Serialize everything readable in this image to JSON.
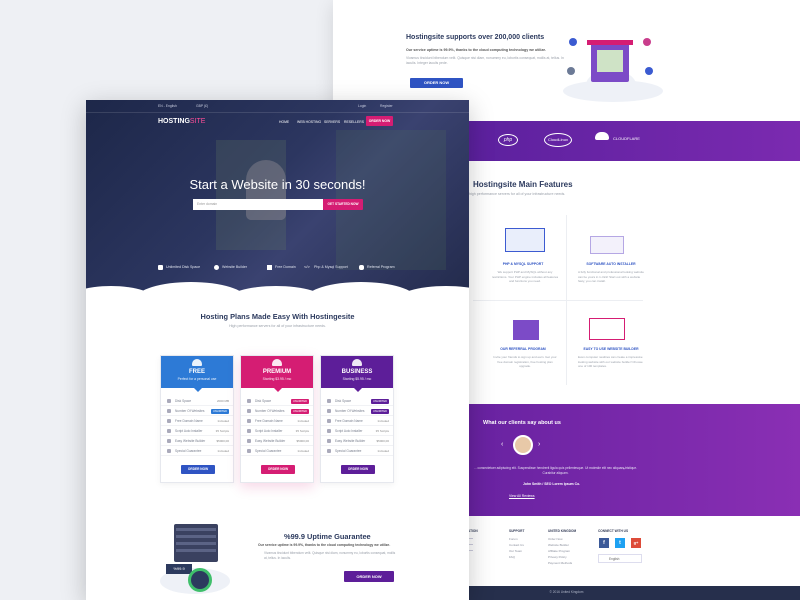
{
  "back": {
    "intro_title": "Hostingsite supports over 200,000 clients",
    "intro_sub": "Our service uptime is 99.9%, thanks to the cloud computing technology we utilize.",
    "intro_body": "Vivamus tincidunt bibendum velit. Quisque nisi diam, nonummy eu, lobortis consequat, mollis at, tellus. In iaculis. Integer iaculis pede.",
    "intro_btn": "ORDER NOW",
    "partners": [
      "php",
      "CloudLinux",
      "CLOUDFLARE"
    ],
    "features_title": "Hostingsite Main Features",
    "features_sub": "high performance servers for all of your infrastructure needs.",
    "features": [
      {
        "title": "PHP & MYSQL SUPPORT",
        "text": "We support PHP and MySQL without any restrictions. Your PHP engine includes all features and functions you need."
      },
      {
        "title": "SOFTWARE AUTO INSTALLER",
        "text": "A fully functional and professional looking website can be yours in 1 click! Start out with a website fasty, you can install."
      },
      {
        "title": "OUR REFERRAL PROGRAM",
        "text": "Invite your friends to sign up and earn. Get your free domain registration, free hosting plan upgrade."
      },
      {
        "title": "EASY TO USE WEBSITE BUILDER",
        "text": "Even computer newbies can create a impressive looking website with our website builder! Choose one of 100 templates."
      }
    ],
    "testimonial_title": "What our clients say about us",
    "testimonial_text": "... consectetuer adipiscing elit. Suspendisse hendrerit ligula quis pellentesque. Ut molestie elit nec aliquam tristique. Curabitur aliquam.",
    "testimonial_author": "John Smith / SEO Lorem Ipsum Co.",
    "testimonial_link": "View All Reviews",
    "footer": {
      "cols": [
        {
          "title": "ATION",
          "items": [
            "",
            "",
            "",
            ""
          ]
        },
        {
          "title": "SUPPORT",
          "items": [
            "Forum",
            "Contact Us",
            "Our Team",
            "FAQ"
          ]
        },
        {
          "title": "UNITED KINGDOM",
          "items": [
            "Order Now",
            "Website Builder",
            "Affiliate Program",
            "Privacy Policy",
            "Payment Methods"
          ]
        },
        {
          "title": "CONNECT WITH US",
          "items": []
        }
      ],
      "language": "English",
      "copyright": "© 2016 United Kingdom"
    }
  },
  "front": {
    "topbar": {
      "language": "EN - English",
      "currency": "GBP (£)",
      "login": "Login",
      "register": "Register"
    },
    "logo_main": "HOSTING",
    "logo_accent": "SITE",
    "nav": [
      "HOME",
      "WEB HOSTING",
      "SERVERS",
      "RESELLERS"
    ],
    "nav_cta": "ORDER NOW",
    "hero_title": "Start a Website in 30 seconds!",
    "domain_placeholder": "Enter domain",
    "domain_button": "GET STARTED NOW",
    "hero_features": [
      "Unlimited Disk Space",
      "Website Builder",
      "Free Domain",
      "Php & Mysql Support",
      "Referral Program"
    ],
    "plans_title": "Hosting Plans Made Easy With Hostingesite",
    "plans_sub": "High performance servers for all of your infrastructure needs.",
    "plans": [
      {
        "name": "FREE",
        "price": "Perfect for a personal use",
        "color": "#2d7ad6",
        "rows": [
          [
            "Disk Space",
            "2000 MB"
          ],
          [
            "Number Of Websites",
            "UNLIMITED"
          ],
          [
            "Free Domain Name",
            "Included"
          ],
          [
            "Script Auto Installer",
            "35 Scripts"
          ],
          [
            "Easy Website Builder",
            "$5000,00"
          ],
          [
            "Special Guarantee",
            "Included"
          ]
        ],
        "button": "ORDER NOW"
      },
      {
        "name": "PREMIUM",
        "price": "Starting $3.95 / mo",
        "color": "#d51d73",
        "rows": [
          [
            "Disk Space",
            "UNLIMITED"
          ],
          [
            "Number Of Websites",
            "UNLIMITED"
          ],
          [
            "Free Domain Name",
            "Included"
          ],
          [
            "Script Auto Installer",
            "35 Scripts"
          ],
          [
            "Easy Website Builder",
            "$5000,00"
          ],
          [
            "Special Guarantee",
            "Included"
          ]
        ],
        "button": "ORDER NOW"
      },
      {
        "name": "BUSINESS",
        "price": "Starting $5.95 / mo",
        "color": "#5d1e99",
        "rows": [
          [
            "Disk Space",
            "UNLIMITED"
          ],
          [
            "Number Of Websites",
            "UNLIMITED"
          ],
          [
            "Free Domain Name",
            "Included"
          ],
          [
            "Script Auto Installer",
            "35 Scripts"
          ],
          [
            "Easy Website Builder",
            "$5000,00"
          ],
          [
            "Special Guarantee",
            "Included"
          ]
        ],
        "button": "ORDER NOW"
      }
    ],
    "uptime_title": "%99.9 Uptime Guarantee",
    "uptime_sub": "Our service uptime is 99.9%, thanks to the cloud computing technology we utilize.",
    "uptime_body": "Vivamus tincidunt bibendum velit. Quisque nisi diam, nonummy eu, lobortis consequat, mollis at, tellus. In iaculis.",
    "uptime_button": "ORDER NOW",
    "gauge_value": "%99.9"
  }
}
